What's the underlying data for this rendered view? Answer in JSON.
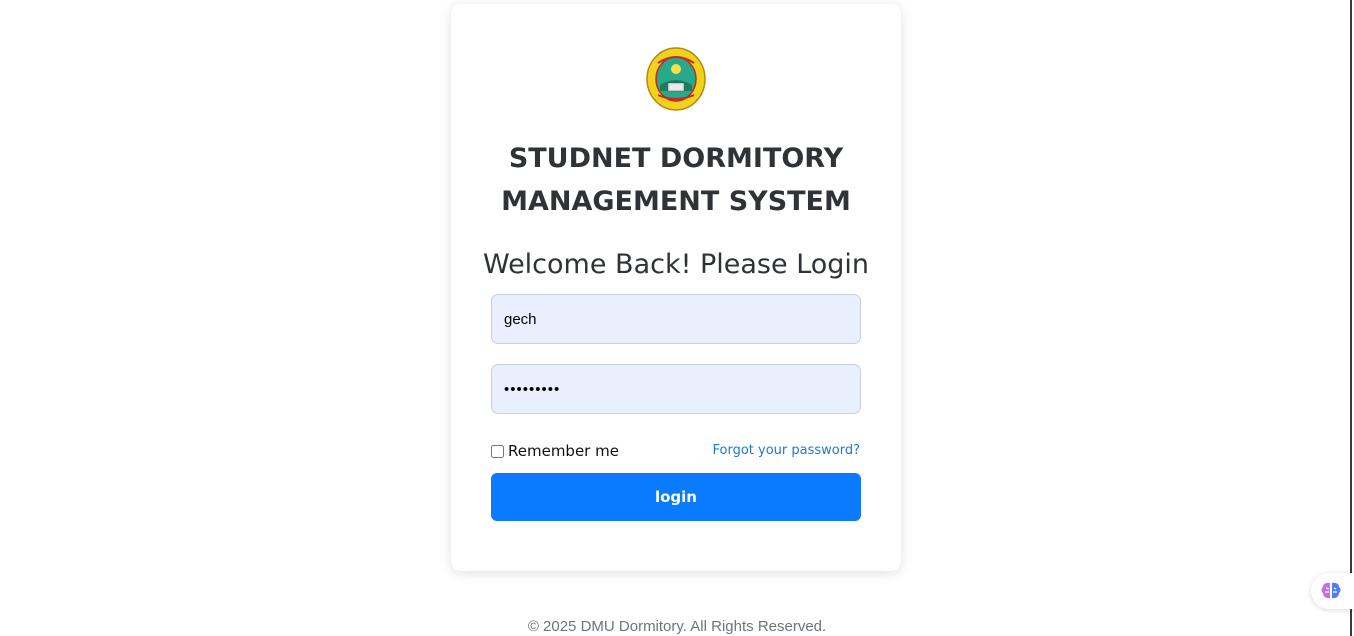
{
  "logo": {
    "icon": "university-seal-icon",
    "colors": {
      "outer": "#f2d21b",
      "inner": "#1e9a7a",
      "accent": "#d62b2b"
    }
  },
  "header": {
    "system_title_line1": "STUDNET DORMITORY",
    "system_title_line2": "MANAGEMENT SYSTEM",
    "welcome": "Welcome Back! Please Login"
  },
  "form": {
    "username_value": "gech",
    "password_value": "•••••••••",
    "remember_label": "Remember me",
    "remember_checked": false,
    "forgot_link": "Forgot your password?",
    "login_button": "login"
  },
  "footer": {
    "copyright": "© 2025 DMU Dormitory. All Rights Reserved."
  },
  "theme": {
    "primary": "#0a7bff",
    "link": "#1a7ad6",
    "input_bg": "#e8f0fe",
    "text": "#2f3337"
  },
  "extension": {
    "icon": "brain-icon"
  }
}
